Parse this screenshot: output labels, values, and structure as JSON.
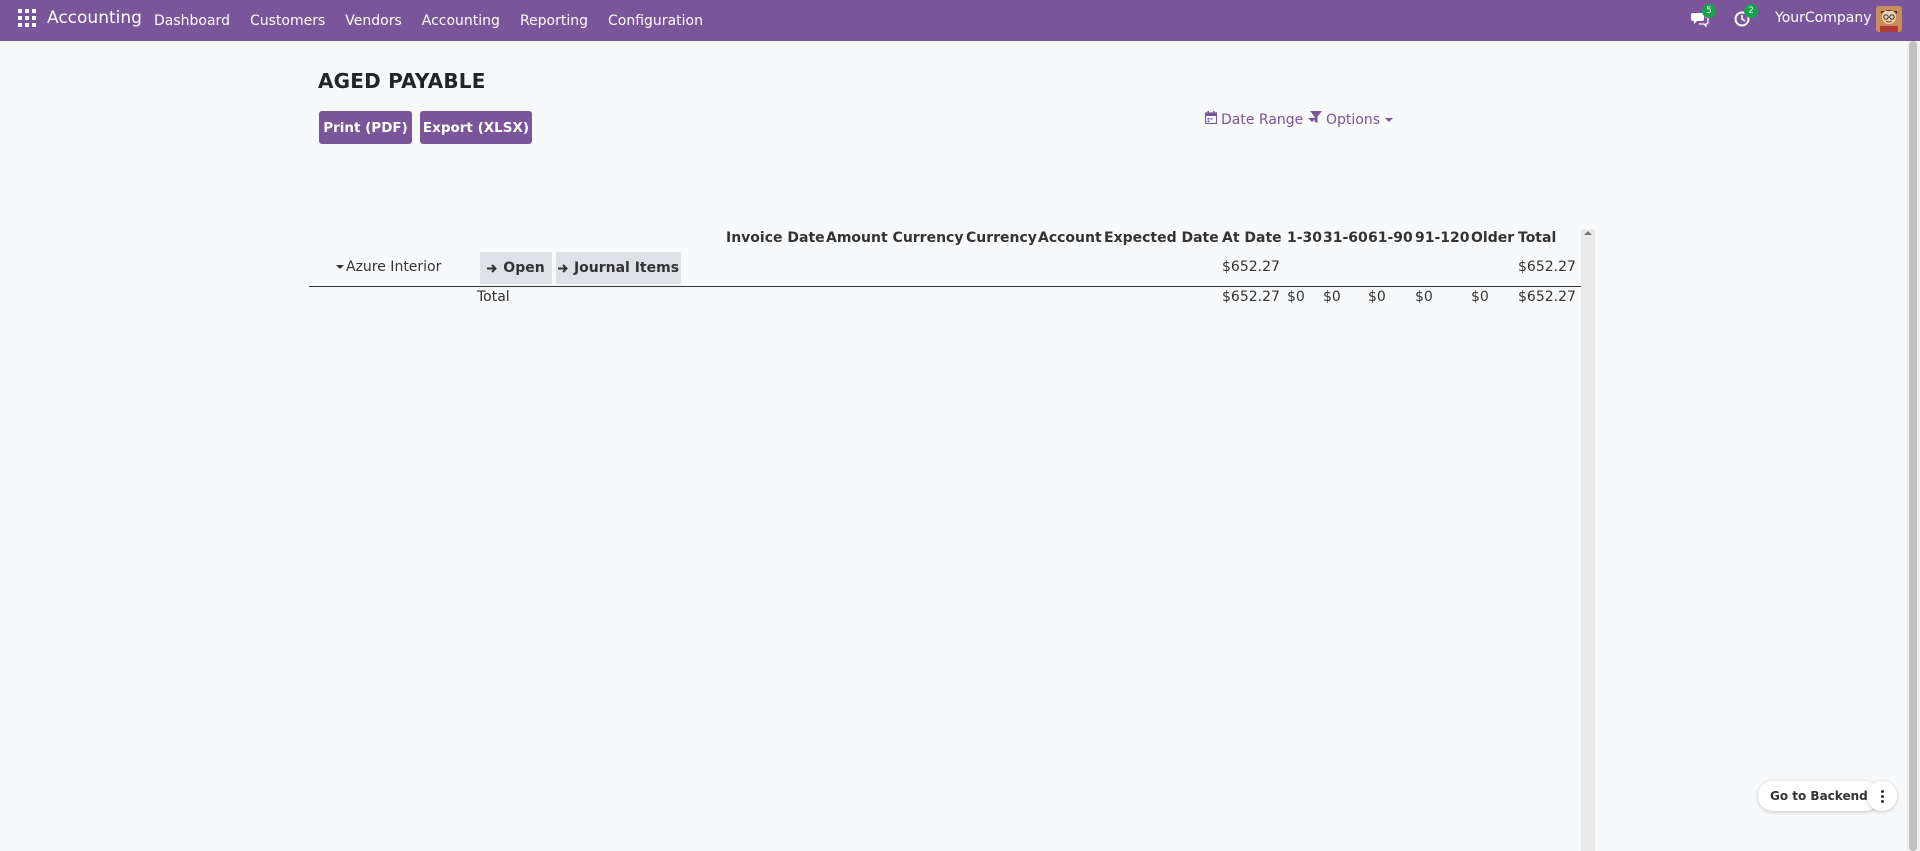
{
  "navbar": {
    "brand": "Accounting",
    "menu": [
      "Dashboard",
      "Customers",
      "Vendors",
      "Accounting",
      "Reporting",
      "Configuration"
    ],
    "messages_badge": "5",
    "activities_badge": "2",
    "company": "YourCompany"
  },
  "report": {
    "title": "AGED PAYABLE",
    "print_label": "Print (PDF)",
    "export_label": "Export (XLSX)",
    "date_range_label": "Date Range",
    "options_label": "Options",
    "columns": [
      "Invoice Date",
      "Amount Currency",
      "Currency",
      "Account",
      "Expected Date",
      "At Date",
      "1-30",
      "31-60",
      "61-90",
      "91-120",
      "Older",
      "Total"
    ],
    "partner_row": {
      "name": "Azure Interior",
      "open_label": "Open",
      "journal_items_label": "Journal Items",
      "at_date": "$652.27",
      "total": "$652.27"
    },
    "total_row": {
      "label": "Total",
      "at_date": "$652.27",
      "d1_30": "$0",
      "d31_60": "$0",
      "d61_90": "$0",
      "d91_120": "$0",
      "older": "$0",
      "total": "$652.27"
    }
  },
  "floating": {
    "go_backend_label": "Go to Backend"
  },
  "colors": {
    "brand_purple": "#7a559a",
    "badge_green": "#17a34a"
  }
}
